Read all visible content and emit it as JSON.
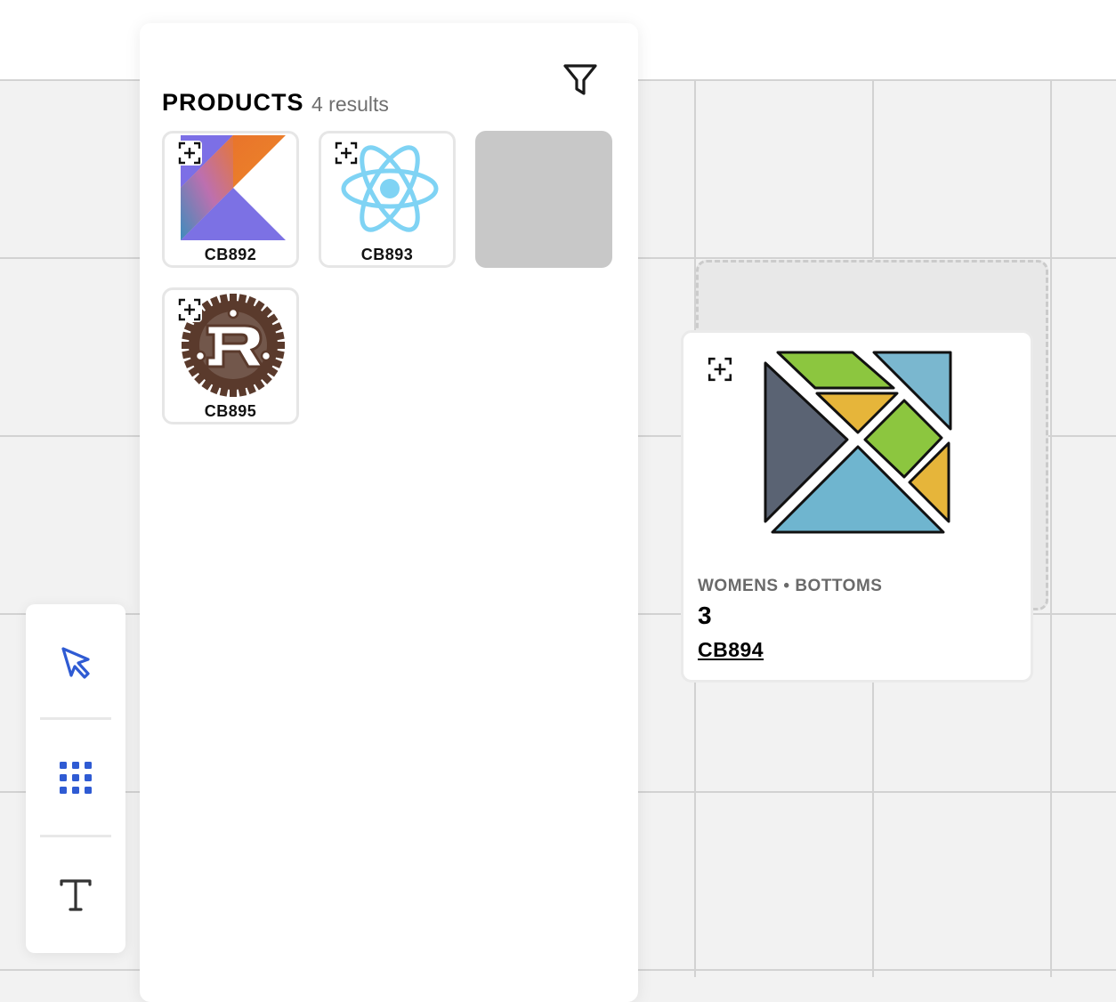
{
  "panel": {
    "title": "PRODUCTS",
    "result_count": "4 results",
    "tiles": [
      {
        "code": "CB892",
        "icon": "kotlin-logo-icon"
      },
      {
        "code": "CB893",
        "icon": "react-logo-icon"
      },
      {
        "code": "",
        "icon": "empty-placeholder"
      },
      {
        "code": "CB895",
        "icon": "rust-logo-icon"
      }
    ]
  },
  "canvas_card": {
    "category": "WOMENS • BOTTOMS",
    "quantity": "3",
    "code": "CB894",
    "icon": "elm-tangram-logo-icon"
  },
  "toolbar": {
    "tools": [
      "select-arrow-icon",
      "grid-dots-icon",
      "text-tool-icon"
    ]
  },
  "colors": {
    "accent": "#2f5bd3",
    "grid_line": "#d2d2d2",
    "placeholder": "#c8c8c8"
  }
}
